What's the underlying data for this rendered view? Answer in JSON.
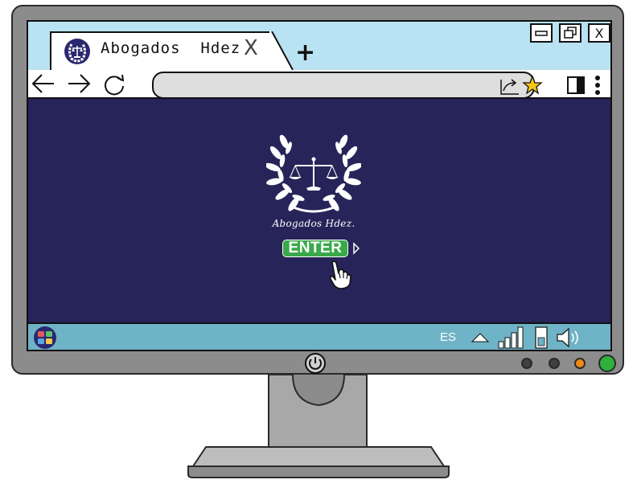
{
  "browser": {
    "tab": {
      "title": "Abogados  Hdez",
      "close_label": "X",
      "favicon": "scales-laurel-icon"
    },
    "new_tab_label": "+",
    "window_controls": {
      "minimize": "minimize-icon",
      "restore": "restore-icon",
      "close": "X"
    },
    "nav": {
      "back": "back-arrow-icon",
      "forward": "forward-arrow-icon",
      "reload": "reload-icon"
    },
    "address_bar": {
      "value": "",
      "placeholder": ""
    },
    "toolbar_icons": [
      "share-icon",
      "star-icon",
      "sidebar-icon",
      "kebab-menu-icon"
    ]
  },
  "page": {
    "logo": "scales-laurel-logo",
    "brand_name": "Abogados Hdez.",
    "enter_button": "ENTER",
    "pointer": "hand-cursor-icon"
  },
  "taskbar": {
    "start_icon": "start-icon",
    "language": "ES",
    "tray": [
      "chevron-up-icon",
      "signal-bars-icon",
      "battery-icon",
      "speaker-icon"
    ]
  },
  "colors": {
    "screen_bg": "#27245a",
    "tabbar_bg": "#b9e2f2",
    "taskbar_bg": "#6eb3c6",
    "enter_bg": "#3aa94a",
    "bezel": "#8c8c8c",
    "led_dark": "#404040",
    "led_orange": "#f08a12",
    "led_green": "#2fb03a"
  }
}
